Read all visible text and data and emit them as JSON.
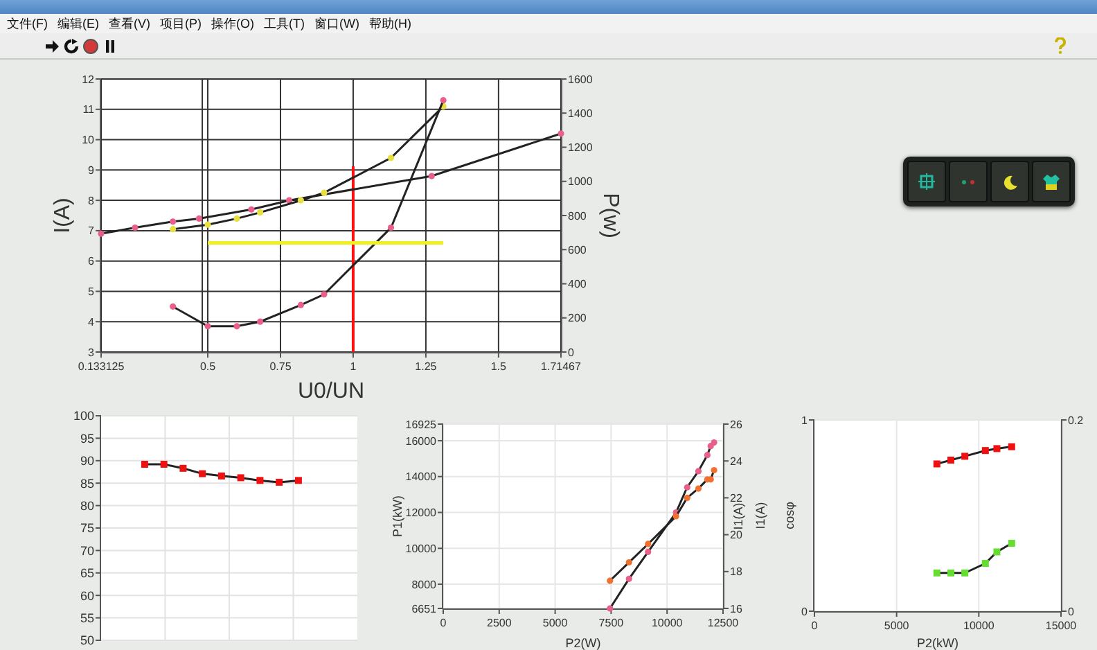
{
  "menu": [
    {
      "label": "文件(F)"
    },
    {
      "label": "编辑(E)"
    },
    {
      "label": "查看(V)"
    },
    {
      "label": "项目(P)"
    },
    {
      "label": "操作(O)"
    },
    {
      "label": "工具(T)"
    },
    {
      "label": "窗口(W)"
    },
    {
      "label": "帮助(H)"
    }
  ],
  "main_graph": {
    "chart_data": {
      "type": "line",
      "xlabel": "U0/UN",
      "ylabel": "I(A)",
      "y2label": "P(w)",
      "x": [
        0.133125,
        0.25,
        0.38,
        0.47,
        0.5,
        0.6,
        0.65,
        0.68,
        0.78,
        0.82,
        0.9,
        1.13,
        1.27,
        1.31,
        1.71467
      ],
      "xlim": [
        0.133125,
        1.71467
      ],
      "xticks": [
        0.133125,
        0.5,
        0.75,
        1,
        1.25,
        1.5,
        1.71467
      ],
      "ylim": [
        3,
        12
      ],
      "yticks": [
        3,
        4,
        5,
        6,
        7,
        8,
        9,
        10,
        11,
        12
      ],
      "y2lim": [
        0,
        1600
      ],
      "y2ticks": [
        0,
        200,
        400,
        600,
        800,
        1000,
        1200,
        1400,
        1600
      ],
      "series": [
        {
          "color": "#e8608a",
          "marker": "circle",
          "values": [
            6.9,
            7.1,
            7.3,
            7.4,
            null,
            null,
            7.7,
            null,
            8.0,
            null,
            null,
            null,
            8.8,
            null,
            10.2
          ]
        },
        {
          "color": "#e6e040",
          "marker": "circle",
          "values": [
            null,
            null,
            7.05,
            null,
            7.2,
            7.4,
            null,
            7.6,
            null,
            8.0,
            8.25,
            9.4,
            null,
            11.1,
            null
          ]
        },
        {
          "color": "#e8608a",
          "marker": "circle",
          "values": [
            null,
            null,
            4.5,
            null,
            3.85,
            3.85,
            null,
            4.0,
            null,
            4.55,
            4.9,
            7.1,
            null,
            11.3,
            null
          ]
        },
        {
          "color": "#f0f020",
          "values": [
            null,
            null,
            null,
            null,
            6.6,
            6.6,
            6.6,
            6.6,
            6.6,
            6.6,
            6.6,
            6.6,
            6.6,
            6.6,
            null
          ]
        }
      ],
      "ref_lines": [
        {
          "axis": "x",
          "value": 1,
          "color": "#ff1010"
        }
      ],
      "grid": true
    }
  },
  "efficiency_graph": {
    "chart_data": {
      "type": "line",
      "grid": true,
      "ylim": [
        50,
        100
      ],
      "yticks": [
        50,
        55,
        60,
        65,
        70,
        75,
        80,
        85,
        90,
        95,
        100
      ],
      "series": [
        {
          "color": "#ee1111",
          "marker": "square",
          "values": [
            89.2,
            89.2,
            88.3,
            87.1,
            86.6,
            86.2,
            85.6,
            85.2,
            85.6
          ]
        }
      ]
    }
  },
  "power_graph": {
    "chart_data": {
      "type": "line",
      "grid": true,
      "xlabel": "P2(W)",
      "ylabel": "P1(kW)",
      "y2label": "I1(A)",
      "x": [
        7450,
        8300,
        9150,
        10400,
        10900,
        11400,
        11800,
        11950,
        12100
      ],
      "xlim": [
        0,
        12500
      ],
      "xticks": [
        0,
        2500,
        5000,
        7500,
        10000,
        12500
      ],
      "ylim": [
        6651,
        16925
      ],
      "yticks": [
        6651,
        8000,
        10000,
        12000,
        14000,
        16000,
        16925
      ],
      "y2lim": [
        16,
        26
      ],
      "y2ticks": [
        16,
        18,
        20,
        22,
        24,
        26
      ],
      "series": [
        {
          "color": "#e8608a",
          "marker": "circle",
          "values": [
            6651,
            8300,
            9800,
            12000,
            13400,
            14300,
            15200,
            15700,
            15900
          ]
        },
        {
          "color": "#f07030",
          "marker": "circle",
          "axis": "y2",
          "values": [
            17.5,
            18.5,
            19.5,
            21,
            22,
            22.5,
            23,
            23,
            23.5
          ]
        }
      ]
    }
  },
  "power_factor_graph": {
    "left_caption": "I1(A)",
    "chart_data": {
      "type": "line",
      "grid": true,
      "xlabel": "P2(kW)",
      "ylabel": "cosφ",
      "x": [
        7450,
        8300,
        9150,
        10400,
        11100,
        12000
      ],
      "xlim": [
        0,
        15000
      ],
      "xticks": [
        0,
        5000,
        10000,
        15000
      ],
      "ylim": [
        0,
        1
      ],
      "yticks": [
        0,
        1
      ],
      "y2lim": [
        0,
        0.2
      ],
      "y2ticks": [
        0,
        0.2
      ],
      "series": [
        {
          "color": "#ee1111",
          "marker": "square",
          "values": [
            0.77,
            0.79,
            0.81,
            0.84,
            0.85,
            0.86
          ]
        },
        {
          "color": "#66dd33",
          "marker": "square",
          "axis": "y2",
          "values": [
            0.04,
            0.04,
            0.04,
            0.05,
            0.062,
            0.071
          ]
        }
      ]
    }
  }
}
